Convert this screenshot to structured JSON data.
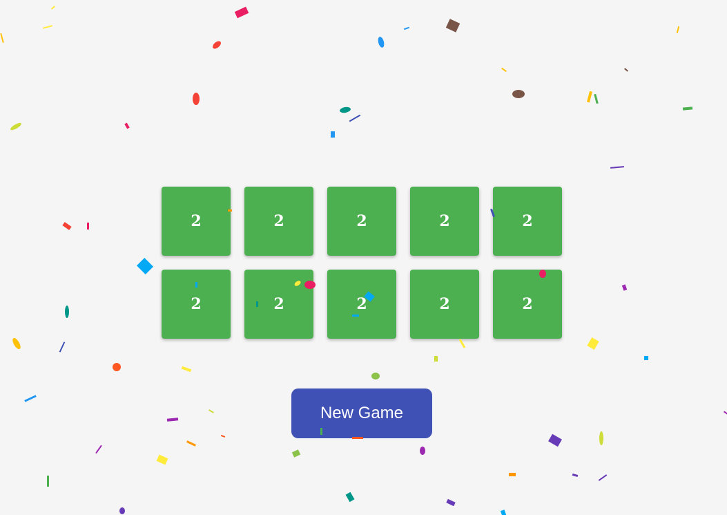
{
  "colors": {
    "background": "#f5f5f5",
    "tile": "#4caf50",
    "tile_text": "#ffffff",
    "button": "#3f51b5",
    "button_text": "#ffffff"
  },
  "board": {
    "rows": 2,
    "columns": 5,
    "tiles": [
      {
        "value": "2"
      },
      {
        "value": "2"
      },
      {
        "value": "2"
      },
      {
        "value": "2"
      },
      {
        "value": "2"
      },
      {
        "value": "2"
      },
      {
        "value": "2"
      },
      {
        "value": "2"
      },
      {
        "value": "2"
      },
      {
        "value": "2"
      }
    ]
  },
  "controls": {
    "new_game_label": "New Game"
  },
  "confetti_palette": [
    "#e91e63",
    "#f44336",
    "#ff9800",
    "#ffeb3b",
    "#cddc39",
    "#8bc34a",
    "#4caf50",
    "#009688",
    "#03a9f4",
    "#2196f3",
    "#3f51b5",
    "#673ab7",
    "#9c27b0",
    "#795548",
    "#ff5722",
    "#ffc107"
  ]
}
